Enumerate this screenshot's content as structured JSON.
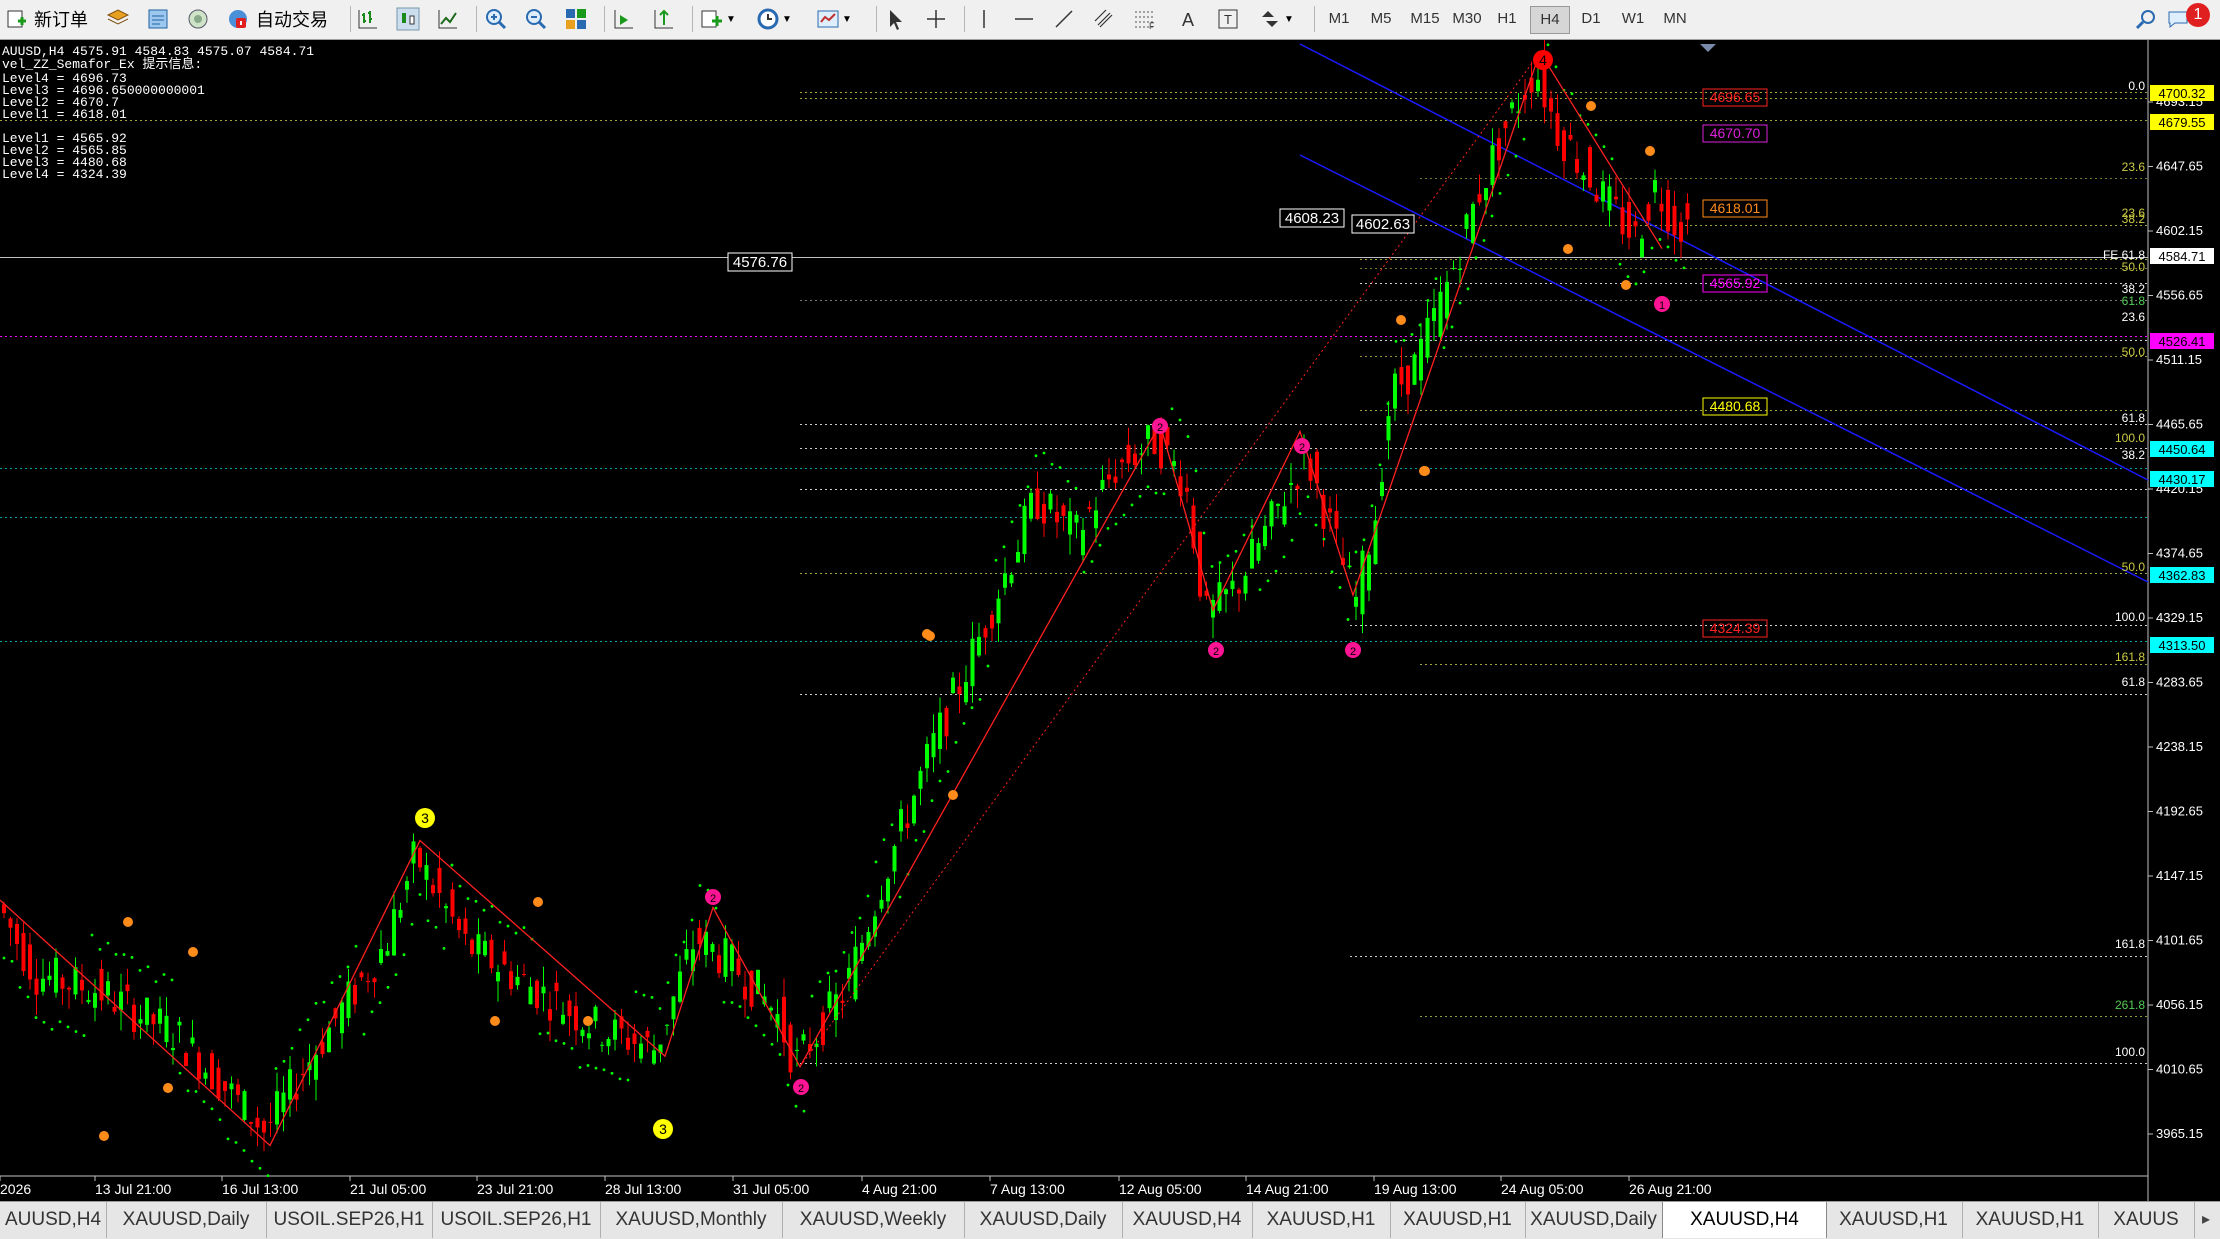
{
  "toolbar": {
    "new_order": "新订单",
    "auto_trading": "自动交易",
    "timeframes": [
      "M1",
      "M5",
      "M15",
      "M30",
      "H1",
      "H4",
      "D1",
      "W1",
      "MN"
    ],
    "active_timeframe": "H4",
    "notification_count": "1"
  },
  "chart_info": {
    "symbol_line": "AUUSD,H4  4575.91 4584.83 4575.07 4584.71",
    "indicator_line": "vel_ZZ_Semafor_Ex 提示信息:",
    "levels_upper": [
      "Level4 = 4696.73",
      "Level3 = 4696.650000000001",
      "Level2 = 4670.7",
      "Level1 = 4618.01"
    ],
    "levels_lower": [
      "Level1 = 4565.92",
      "Level2 = 4565.85",
      "Level3 = 4480.68",
      "Level4 = 4324.39"
    ]
  },
  "chart_data": {
    "type": "candlestick",
    "symbol": "XAUUSD",
    "timeframe": "H4",
    "current_price": 4584.71,
    "y_ticks": [
      4693.15,
      4647.65,
      4602.15,
      4556.65,
      4511.15,
      4465.65,
      4420.15,
      4374.65,
      4329.15,
      4283.65,
      4238.15,
      4192.65,
      4147.15,
      4101.65,
      4056.15,
      4010.65,
      3965.15
    ],
    "x_ticks": [
      "2026",
      "13 Jul 21:00",
      "16 Jul 13:00",
      "21 Jul 05:00",
      "23 Jul 21:00",
      "28 Jul 13:00",
      "31 Jul 05:00",
      "4 Aug 21:00",
      "7 Aug 13:00",
      "12 Aug 05:00",
      "14 Aug 21:00",
      "19 Aug 13:00",
      "24 Aug 05:00",
      "26 Aug 21:00"
    ],
    "price_tags": [
      {
        "value": "4700.32",
        "bg": "#ffff00",
        "fg": "#000000"
      },
      {
        "value": "4679.55",
        "bg": "#ffff00",
        "fg": "#000000"
      },
      {
        "value": "4584.71",
        "bg": "#ffffff",
        "fg": "#000000"
      },
      {
        "value": "4526.41",
        "bg": "#ff00ff",
        "fg": "#000000"
      },
      {
        "value": "4450.64",
        "bg": "#00ffff",
        "fg": "#000000"
      },
      {
        "value": "4430.17",
        "bg": "#00ffff",
        "fg": "#000000"
      },
      {
        "value": "4362.83",
        "bg": "#00ffff",
        "fg": "#000000"
      },
      {
        "value": "4313.50",
        "bg": "#00ffff",
        "fg": "#000000"
      }
    ],
    "level_boxes": [
      {
        "value": "4696.65",
        "color": "#ff2222"
      },
      {
        "value": "4670.70",
        "color": "#dd22dd"
      },
      {
        "value": "4618.01",
        "color": "#ff8c1a"
      },
      {
        "value": "4565.92",
        "color": "#ff00ff"
      },
      {
        "value": "4480.68",
        "color": "#ffff00"
      },
      {
        "value": "4324.39",
        "color": "#ff2222"
      }
    ],
    "chart_labels": [
      "4608.23",
      "4602.63",
      "4576.76"
    ],
    "fib_labels": [
      {
        "text": "0.0",
        "color": "#ffffff"
      },
      {
        "text": "23.6",
        "color": "#cccc44"
      },
      {
        "text": "23.6",
        "color": "#cccc44"
      },
      {
        "text": "38.2",
        "color": "#cccc44"
      },
      {
        "text": "FE 61.8",
        "color": "#ffffff"
      },
      {
        "text": "50.0",
        "color": "#cccc44"
      },
      {
        "text": "38.2",
        "color": "#ffffff"
      },
      {
        "text": "61.8",
        "color": "#55cc55"
      },
      {
        "text": "23.6",
        "color": "#ffffff"
      },
      {
        "text": "50.0",
        "color": "#cccc44"
      },
      {
        "text": "61.8",
        "color": "#ffffff"
      },
      {
        "text": "100.0",
        "color": "#cccc44"
      },
      {
        "text": "38.2",
        "color": "#ffffff"
      },
      {
        "text": "50.0",
        "color": "#cccc44"
      },
      {
        "text": "100.0",
        "color": "#ffffff"
      },
      {
        "text": "161.8",
        "color": "#cccc44"
      },
      {
        "text": "61.8",
        "color": "#ffffff"
      },
      {
        "text": "161.8",
        "color": "#ffffff"
      },
      {
        "text": "261.8",
        "color": "#55cc55"
      },
      {
        "text": "100.0",
        "color": "#ffffff"
      }
    ],
    "semafor_labels": [
      "4",
      "3",
      "3",
      "2",
      "2",
      "2",
      "2",
      "2",
      "2",
      "1"
    ],
    "colors": {
      "bull": "#00ff00",
      "bear": "#ff0000",
      "zigzag": "#ff2020",
      "channel": "#1a1aff",
      "psar": "#00ff00",
      "semafor1": "#ff8c1a",
      "semafor2": "#ff1493",
      "semafor3": "#ffff00",
      "semafor4": "#ff0000"
    }
  },
  "tabs": [
    "AUUSD,H4",
    "XAUUSD,Daily",
    "USOIL.SEP26,H1",
    "USOIL.SEP26,H1",
    "XAUUSD,Monthly",
    "XAUUSD,Weekly",
    "XAUUSD,Daily",
    "XAUUSD,H4",
    "XAUUSD,H1",
    "XAUUSD,H1",
    "XAUUSD,Daily",
    "XAUUSD,H4",
    "XAUUSD,H1",
    "XAUUSD,H1",
    "XAUUS"
  ],
  "active_tab": 11
}
